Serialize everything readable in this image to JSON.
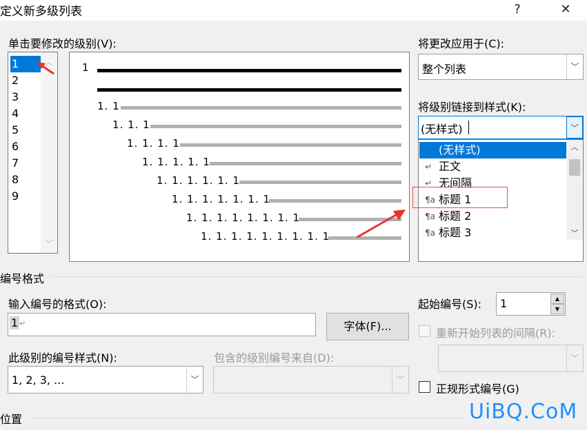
{
  "window": {
    "title": "定义新多级列表",
    "help_label": "?",
    "close_label": "✕"
  },
  "levels": {
    "label": "单击要修改的级别(V):",
    "items": [
      "1",
      "2",
      "3",
      "4",
      "5",
      "6",
      "7",
      "8",
      "9"
    ],
    "selected": "1"
  },
  "preview": {
    "row1": "1",
    "row3": "1. 1",
    "row4": "1. 1. 1",
    "row5": "1. 1. 1. 1",
    "row6": "1. 1. 1. 1. 1",
    "row7": "1. 1. 1. 1. 1. 1",
    "row8": "1. 1. 1. 1. 1. 1. 1",
    "row9": "1. 1. 1. 1. 1. 1. 1. 1",
    "row10": "1. 1. 1. 1. 1. 1. 1. 1. 1"
  },
  "apply_to": {
    "label": "将更改应用于(C):",
    "value": "整个列表"
  },
  "link_style": {
    "label": "将级别链接到样式(K):",
    "value": "(无样式)",
    "options": [
      {
        "label": "(无样式)",
        "icon": "",
        "selected": true
      },
      {
        "label": "正文",
        "icon": "paragraph-return-icon"
      },
      {
        "label": "无间隔",
        "icon": "paragraph-return-icon"
      },
      {
        "label": "标题 1",
        "icon": "linked-style-icon"
      },
      {
        "label": "标题 2",
        "icon": "linked-style-icon"
      },
      {
        "label": "标题 3",
        "icon": "linked-style-icon"
      }
    ]
  },
  "number_format": {
    "section_label": "编号格式",
    "format_label": "输入编号的格式(O):",
    "format_value": "1",
    "font_button": "字体(F)...",
    "style_label": "此级别的编号样式(N):",
    "style_value": "1, 2, 3, ...",
    "include_label": "包含的级别编号来自(D):",
    "include_value": ""
  },
  "start_at": {
    "label": "起始编号(S):",
    "value": "1"
  },
  "restart": {
    "label": "重新开始列表的间隔(R):",
    "value": ""
  },
  "legal": {
    "label": "正规形式编号(G)",
    "checked": false
  },
  "position": {
    "section_label": "位置"
  },
  "watermark": {
    "text": "UiBQ.CoM"
  },
  "colors": {
    "selection": "#0078d7",
    "annotation": "#e8322c",
    "highlight_box": "#d9534f",
    "watermark": "#1e90ff"
  }
}
